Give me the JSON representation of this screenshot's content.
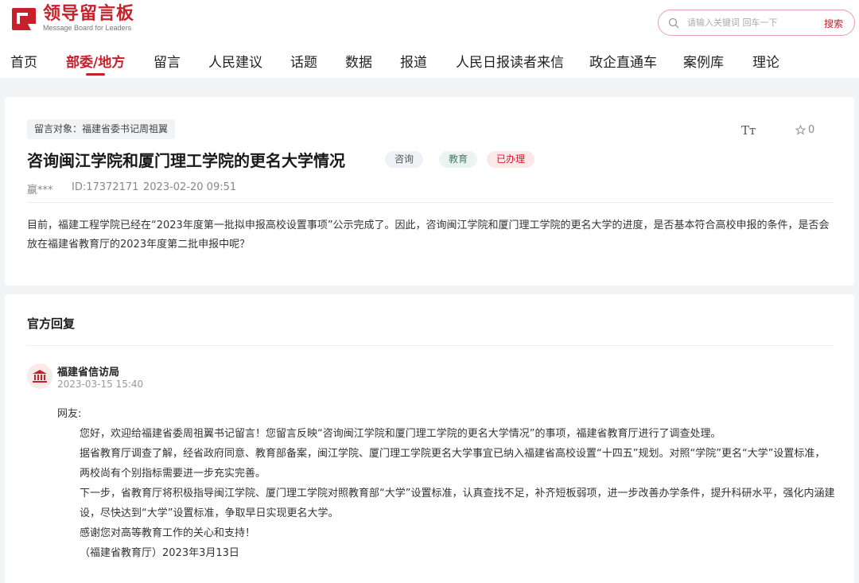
{
  "brand": {
    "name_cn": "领导留言板",
    "name_en": "Message Board for Leaders",
    "accent": "#c8202b"
  },
  "search": {
    "placeholder": "请输入关键词 回车一下",
    "button": "搜索"
  },
  "nav": [
    "首页",
    "部委/地方",
    "留言",
    "人民建议",
    "话题",
    "数据",
    "报道",
    "人民日报读者来信",
    "政企直通车",
    "案例库",
    "理论"
  ],
  "nav_active": "部委/地方",
  "message": {
    "target": "留言对象：福建省委书记周祖翼",
    "font_size_icon": "Tт",
    "favorites": "0",
    "title": "咨询闽江学院和厦门理工学院的更名大学情况",
    "badges": [
      "咨询",
      "教育",
      "已办理"
    ],
    "author": "嬴***",
    "id": "ID:17372171",
    "time": "2023-02-20 09:51",
    "content": "目前，福建工程学院已经在“2023年度第一批拟申报高校设置事项”公示完成了。因此，咨询闽江学院和厦门理工学院的更名大学的进度，是否基本符合高校申报的条件，是否会放在福建省教育厅的2023年度第二批申报中呢？"
  },
  "reply": {
    "heading": "官方回复",
    "org": "福建省信访局",
    "time": "2023-03-15 15:40",
    "greeting": "网友:",
    "p1": "您好，欢迎给福建省委周祖翼书记留言！您留言反映“咨询闽江学院和厦门理工学院的更名大学情况”的事项，福建省教育厅进行了调查处理。",
    "p2": " 据省教育厅调查了解，经省政府同意、教育部备案，闽江学院、厦门理工学院更名大学事宜已纳入福建省高校设置“十四五”规划。对照“学院”更名“大学”设置标准，两校尚有个别指标需要进一步充实完善。",
    "p3": "下一步，省教育厅将积极指导闽江学院、厦门理工学院对照教育部“大学”设置标准，认真查找不足，补齐短板弱项，进一步改善办学条件，提升科研水平，强化内涵建设，尽快达到“大学”设置标准，争取早日实现更名大学。",
    "p4": "感谢您对高等教育工作的关心和支持！",
    "p5": "（福建省教育厅）2023年3月13日"
  }
}
